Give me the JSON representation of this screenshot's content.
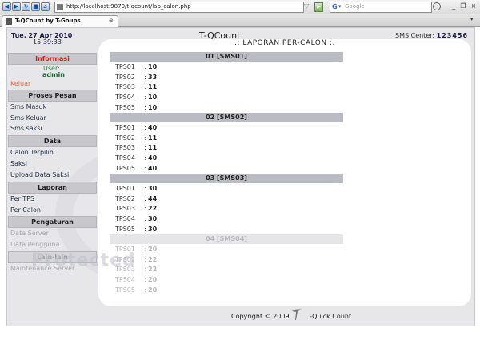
{
  "browser": {
    "url": "http://localhost:9870/t-qcount/lap_calon.php",
    "search_placeholder": "Google",
    "search_logo": "G",
    "tab_title": "T-QCount by T-Goups",
    "window_buttons": [
      "_",
      "❐",
      "×"
    ],
    "nav_icons": [
      "back-icon",
      "forward-icon",
      "reload-icon",
      "stop-icon",
      "home-icon",
      "history-icon"
    ]
  },
  "header": {
    "date": "Tue, 27 Apr 2010",
    "time": "15:39:33",
    "app_title": "T-QCount",
    "sms_center_label": "SMS Center:",
    "sms_center_value": "123456"
  },
  "sidebar": {
    "informasi": "Informasi",
    "user_label": "User:",
    "user_value": "admin",
    "logout": "Keluar",
    "proses_pesan": "Proses Pesan",
    "proses_items": [
      "Sms Masuk",
      "Sms Keluar",
      "Sms saksi"
    ],
    "data": "Data",
    "data_items": [
      "Calon Terpilih",
      "Saksi",
      "Upload Data Saksi"
    ],
    "laporan": "Laporan",
    "laporan_items": [
      "Per TPS",
      "Per Calon"
    ],
    "pengaturan": "Pengaturan",
    "pengaturan_items": [
      "Data Server",
      "Data Pengguna"
    ],
    "lain_lain": "Lain-lain",
    "lain_items": [
      "Maintenance Server"
    ]
  },
  "report": {
    "title": ".: LAPORAN PER-CALON :.",
    "separator": ":",
    "groups": [
      {
        "head": "01 [SMS01]",
        "rows": [
          [
            "TPS01",
            "10"
          ],
          [
            "TPS02",
            "33"
          ],
          [
            "TPS03",
            "11"
          ],
          [
            "TPS04",
            "10"
          ],
          [
            "TPS05",
            "10"
          ]
        ]
      },
      {
        "head": "02 [SMS02]",
        "rows": [
          [
            "TPS01",
            "40"
          ],
          [
            "TPS02",
            "11"
          ],
          [
            "TPS03",
            "11"
          ],
          [
            "TPS04",
            "40"
          ],
          [
            "TPS05",
            "40"
          ]
        ]
      },
      {
        "head": "03 [SMS03]",
        "rows": [
          [
            "TPS01",
            "30"
          ],
          [
            "TPS02",
            "44"
          ],
          [
            "TPS03",
            "22"
          ],
          [
            "TPS04",
            "30"
          ],
          [
            "TPS05",
            "30"
          ]
        ]
      },
      {
        "head": "04 [SMS04]",
        "rows": [
          [
            "TPS01",
            "20"
          ],
          [
            "TPS02",
            "22"
          ],
          [
            "TPS03",
            "22"
          ],
          [
            "TPS04",
            "20"
          ],
          [
            "TPS05",
            "20"
          ]
        ]
      }
    ]
  },
  "footer": {
    "copyright": "Copyright © 2009",
    "brand": "-Quick Count"
  },
  "watermark": "Protected"
}
